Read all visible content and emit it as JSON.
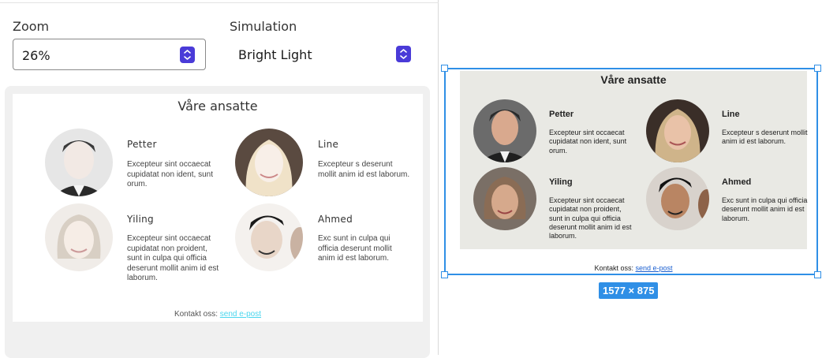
{
  "controls": {
    "zoom_label": "Zoom",
    "zoom_value": "26%",
    "simulation_label": "Simulation",
    "simulation_value": "Bright Light"
  },
  "card": {
    "title": "Våre ansatte",
    "contact_text": "Kontakt oss:",
    "contact_link": "send e-post"
  },
  "people": [
    {
      "name": "Petter",
      "desc": "Excepteur sint occaecat cupidatat non ident, sunt orum.",
      "avatar": "man-suit-portrait"
    },
    {
      "name": "Line",
      "desc": "Excepteur s deserunt mollit anim id est laborum.",
      "avatar": "blonde-woman-portrait"
    },
    {
      "name": "Yiling",
      "desc": "Excepteur sint occaecat cupidatat non proident, sunt in culpa qui officia deserunt mollit anim id est laborum.",
      "avatar": "woman-portrait"
    },
    {
      "name": "Ahmed",
      "desc": "Exc sunt in culpa qui officia deserunt mollit anim id est laborum.",
      "avatar": "man-portrait"
    }
  ],
  "canvas": {
    "size_badge": "1577 × 875"
  },
  "colors": {
    "accent": "#2f8fe6",
    "stepper": "#4a3bd8",
    "bright_link": "#4ad6ee",
    "normal_link": "#1a5fd0"
  }
}
